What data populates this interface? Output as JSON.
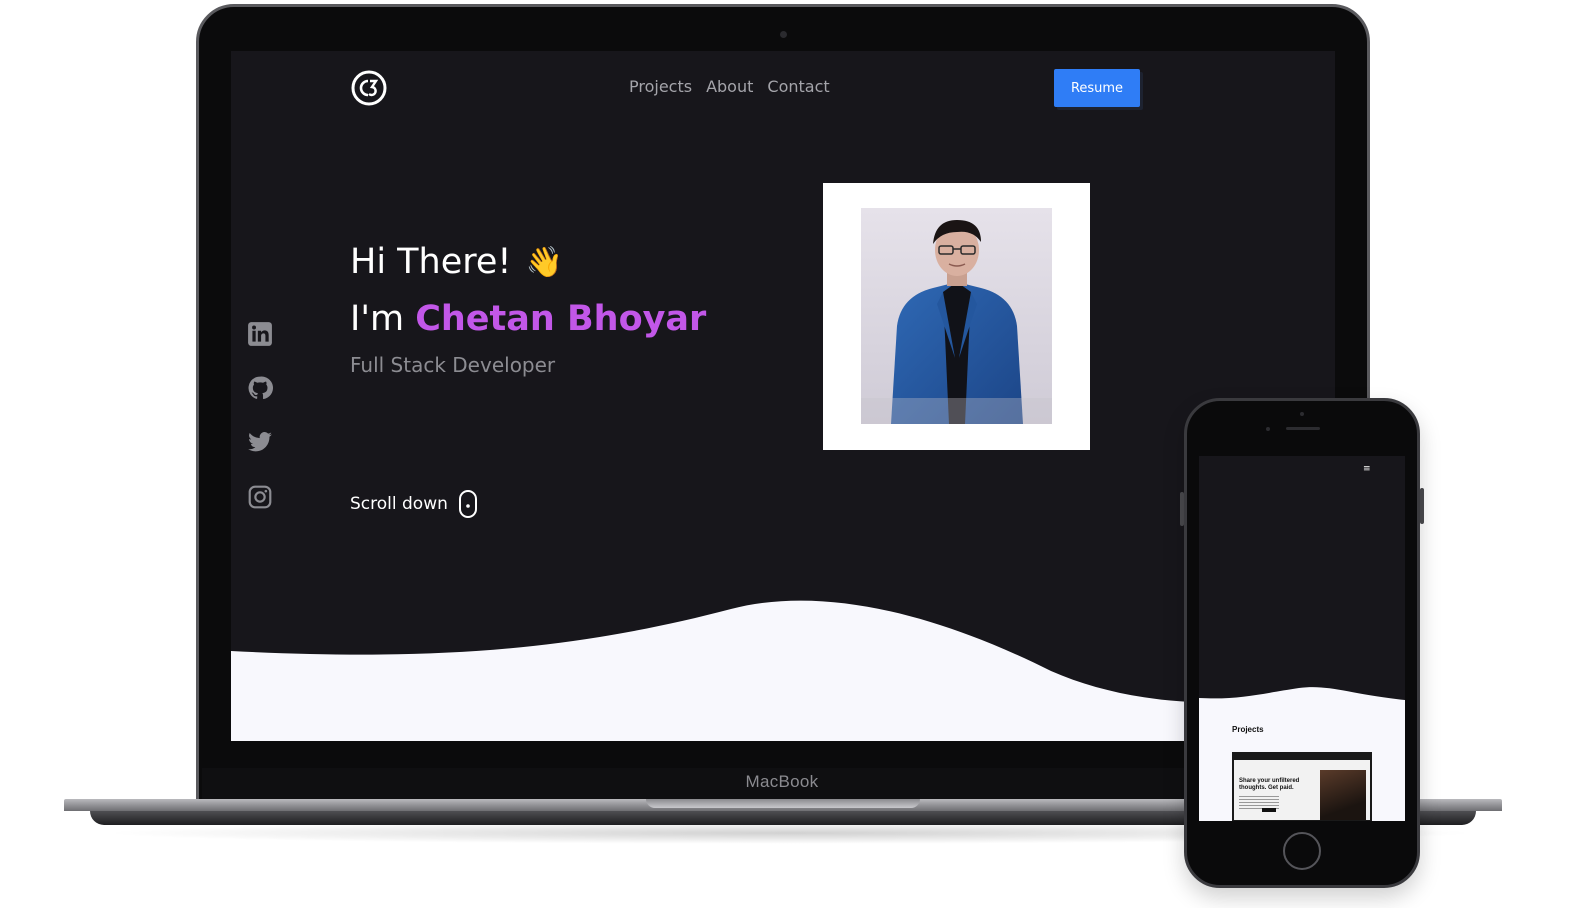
{
  "device_label": "MacBook",
  "site": {
    "logo_alt": "C3 logo",
    "nav": [
      "Projects",
      "About",
      "Contact"
    ],
    "resume_label": "Resume",
    "greeting": "Hi There!",
    "wave_emoji": "👋",
    "intro_prefix": "I'm",
    "name": "Chetan Bhoyar",
    "role": "Full Stack Developer",
    "scroll_label": "Scroll down",
    "social_icons": [
      "linkedin-icon",
      "github-icon",
      "twitter-icon",
      "instagram-icon"
    ]
  },
  "mobile": {
    "menu_icon": "≡",
    "section_title": "Projects",
    "card_title": "Share your unfiltered thoughts. Get paid."
  },
  "colors": {
    "background": "#17161b",
    "accent_name": "#c257e8",
    "resume_button": "#2f7df6",
    "wave": "#f8f8fd"
  }
}
